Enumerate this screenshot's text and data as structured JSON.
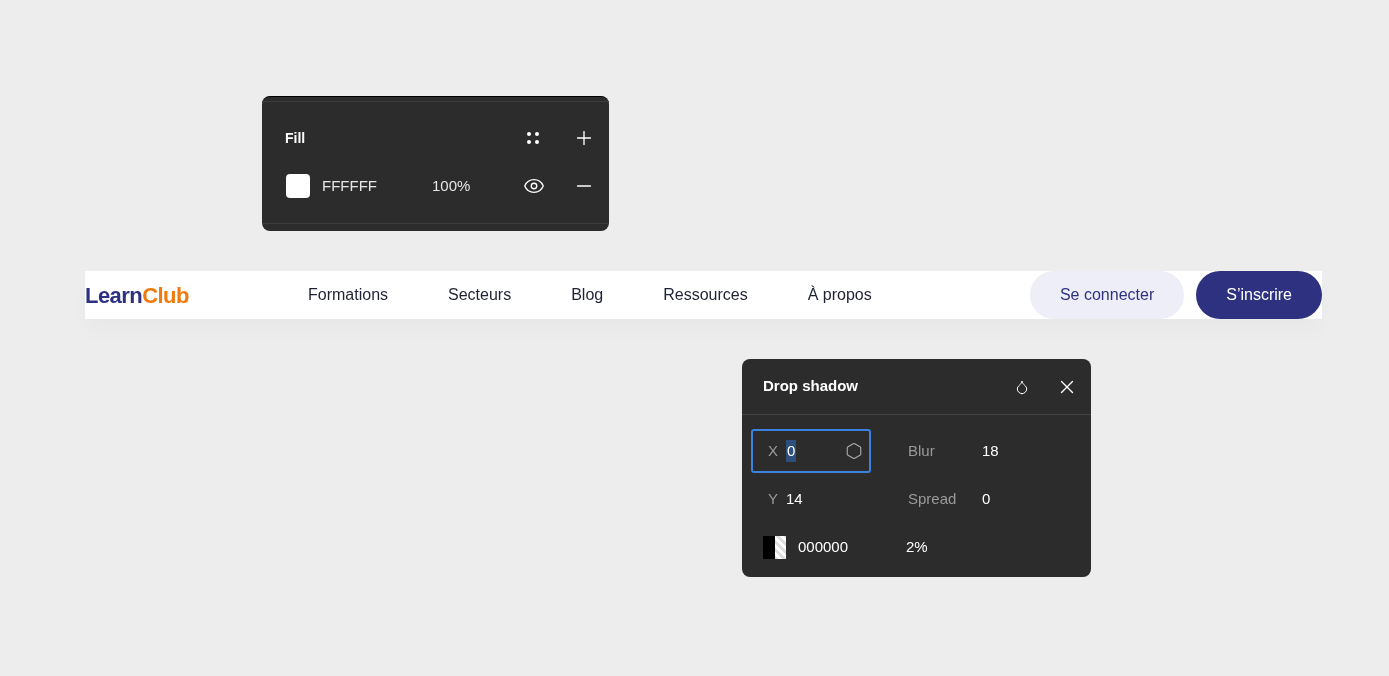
{
  "fill_panel": {
    "title": "Fill",
    "fill": {
      "color": "#ffffff",
      "hex": "FFFFFF",
      "opacity": "100%",
      "visible": true
    }
  },
  "navbar": {
    "logo": {
      "first": "Learn",
      "second": "Club"
    },
    "links": [
      "Formations",
      "Secteurs",
      "Blog",
      "Ressources",
      "À propos"
    ],
    "buttons": [
      {
        "label": "Se connecter",
        "kind": "secondary"
      },
      {
        "label": "S’inscrire",
        "kind": "primary"
      }
    ]
  },
  "drop_shadow_panel": {
    "title": "Drop shadow",
    "fields": [
      {
        "label": "X",
        "value": "0",
        "focused": true
      },
      {
        "label": "Blur",
        "value": "18",
        "focused": false
      },
      {
        "label": "Y",
        "value": "14",
        "focused": false
      },
      {
        "label": "Spread",
        "value": "0",
        "focused": false
      }
    ],
    "color": {
      "hex": "000000",
      "opacity": "2%"
    }
  }
}
